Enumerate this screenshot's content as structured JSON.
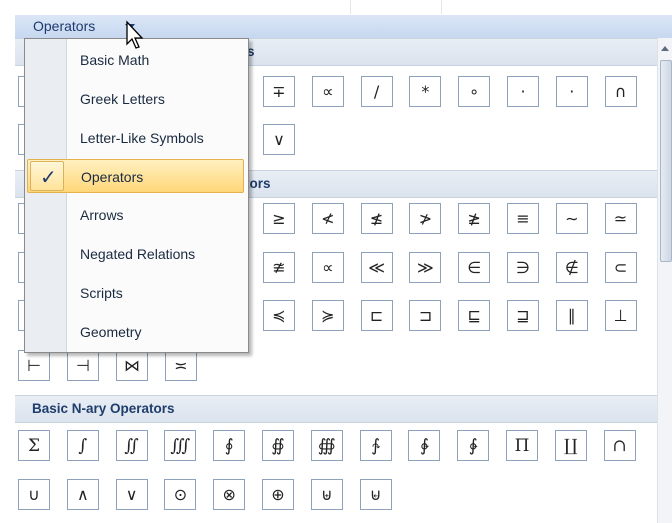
{
  "topbar": {
    "title": "Operators"
  },
  "sections": {
    "basic_math_tail": "s",
    "operators_tail": "tors",
    "basic_nary": "Basic N-ary Operators"
  },
  "menu": {
    "items": [
      {
        "label": "Basic Math",
        "selected": false
      },
      {
        "label": "Greek Letters",
        "selected": false
      },
      {
        "label": "Letter-Like Symbols",
        "selected": false
      },
      {
        "label": "Operators",
        "selected": true
      },
      {
        "label": "Arrows",
        "selected": false
      },
      {
        "label": "Negated Relations",
        "selected": false
      },
      {
        "label": "Scripts",
        "selected": false
      },
      {
        "label": "Geometry",
        "selected": false
      }
    ],
    "check_mark": "✓"
  },
  "symbols": {
    "basic_math_row1": [
      "∓",
      "∝",
      "/",
      "*",
      "∘",
      "·",
      "·",
      "∩"
    ],
    "basic_math_row2": [
      "∨"
    ],
    "operators_row1": [
      "≥",
      "≮",
      "≰",
      "≯",
      "≱",
      "≡",
      "∼",
      "≃"
    ],
    "operators_row2": [
      "≇",
      "∝",
      "≪",
      "≫",
      "∈",
      "∋",
      "∉",
      "⊂"
    ],
    "operators_row3": [
      "≼",
      "≽",
      "⊏",
      "⊐",
      "⊑",
      "⊒",
      "∥",
      "⊥"
    ],
    "operators_row4": [
      "⊢",
      "⊣",
      "⋈",
      "≍"
    ],
    "nary_row1": [
      "Σ",
      "∫",
      "∬",
      "∭",
      "∮",
      "∯",
      "∰",
      "∱",
      "∲",
      "∳",
      "Π",
      "∐",
      "∩"
    ],
    "nary_row2": [
      "∪",
      "∧",
      "∨",
      "⊙",
      "⊗",
      "⊕",
      "⊎",
      "⊌"
    ]
  }
}
